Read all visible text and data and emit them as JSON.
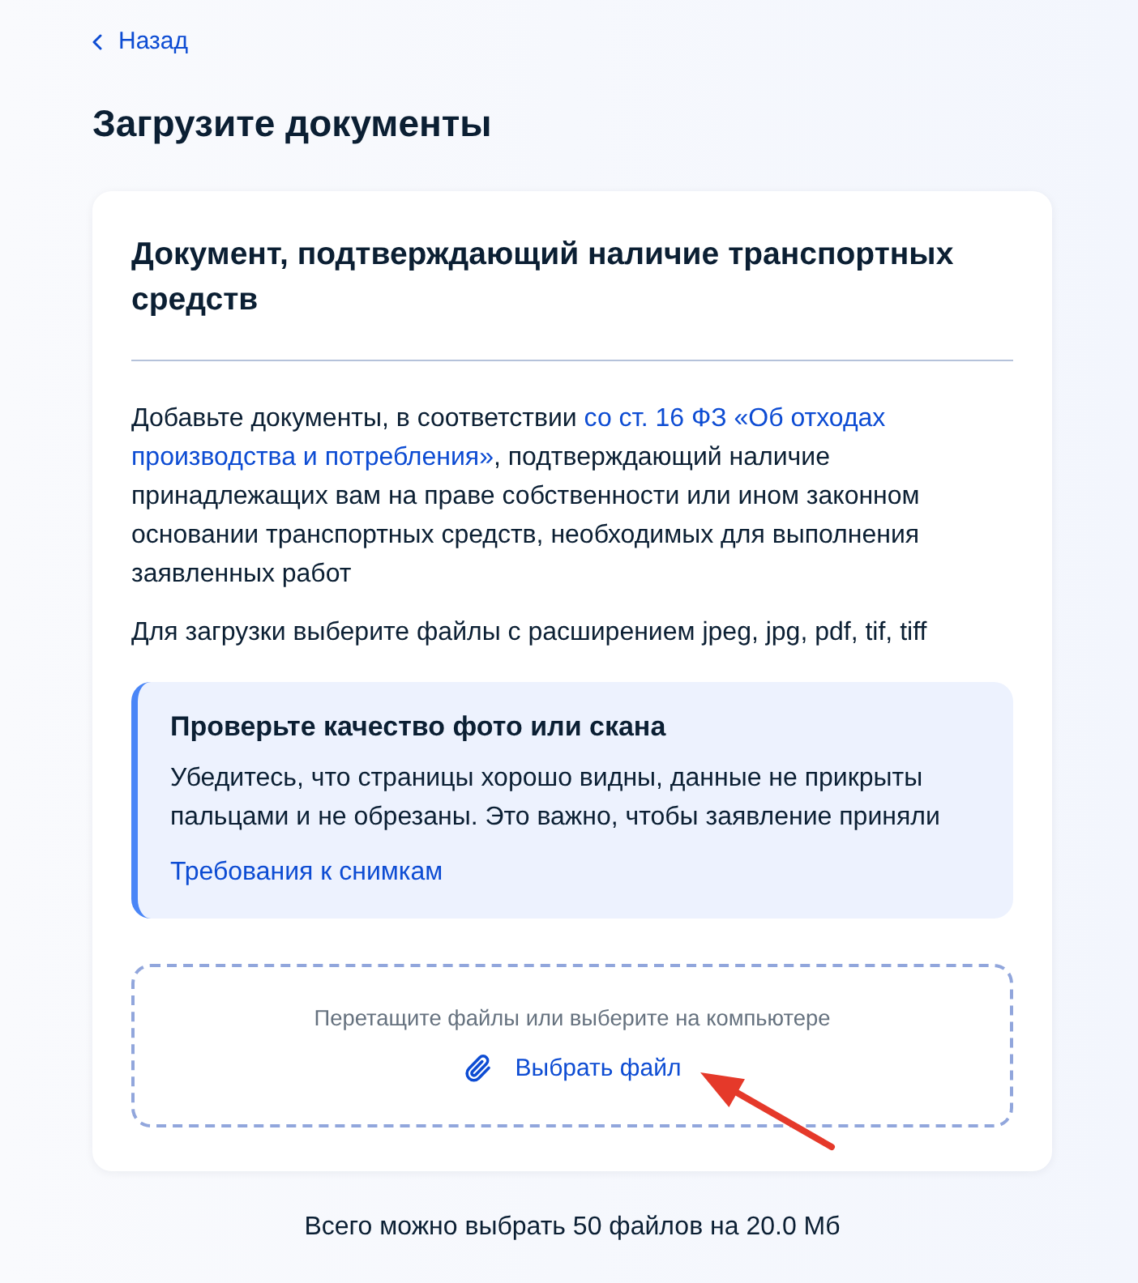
{
  "back_link": {
    "label": "Назад"
  },
  "page_title": "Загрузите документы",
  "card": {
    "title": "Документ, подтверждающий наличие транспортных средств",
    "description": {
      "before": "Добавьте документы, в соответствии ",
      "link_lines": [
        "со ст. 16 ФЗ «Об отходах",
        "производства и потребления»"
      ],
      "after": ", подтверждающий наличие принадлежащих вам на праве собственности или ином законном основании транспортных средств, необходимых для выполнения заявленных работ"
    },
    "formats_note": "Для загрузки выберите файлы с расширением jpeg, jpg, pdf, tif, tiff",
    "notice": {
      "title": "Проверьте качество фото или скана",
      "text": "Убедитесь, что страницы хорошо видны, данные не прикрыты пальцами и не обрезаны. Это важно, чтобы заявление приняли",
      "link": "Требования к снимкам"
    },
    "dropzone": {
      "hint": "Перетащите файлы или выберите на компьютере",
      "button": "Выбрать файл"
    }
  },
  "annotation": {
    "kind": "arrow"
  },
  "limit_note": "Всего можно выбрать 50 файлов на 20.0 Мб"
}
